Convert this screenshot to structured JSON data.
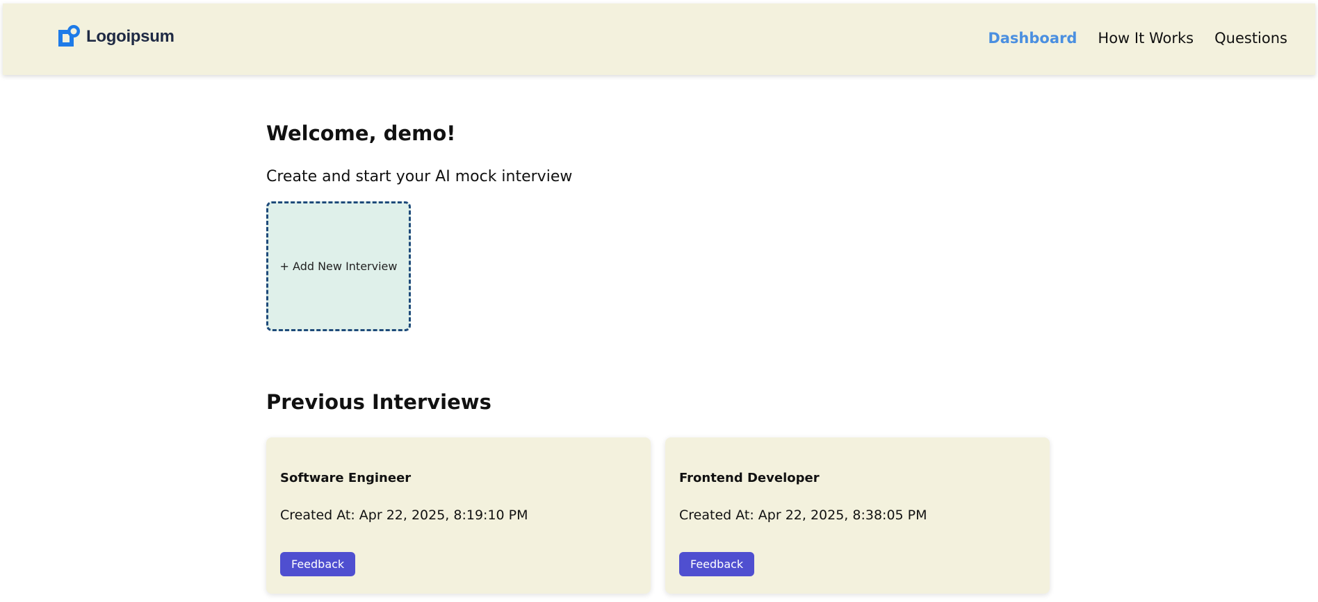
{
  "header": {
    "logo_text": "Logoipsum",
    "nav": [
      {
        "label": "Dashboard",
        "active": true
      },
      {
        "label": "How It Works",
        "active": false
      },
      {
        "label": "Questions",
        "active": false
      }
    ]
  },
  "main": {
    "welcome": "Welcome, demo!",
    "subtitle": "Create and start your AI mock interview",
    "add_interview_label": "+ Add New Interview",
    "previous_title": "Previous Interviews",
    "interviews": [
      {
        "title": "Software Engineer",
        "created": "Created At: Apr 22, 2025, 8:19:10 PM",
        "button": "Feedback"
      },
      {
        "title": "Frontend Developer",
        "created": "Created At: Apr 22, 2025, 8:38:05 PM",
        "button": "Feedback"
      }
    ]
  },
  "colors": {
    "header_bg": "#f3f1dd",
    "nav_active": "#4a8fe0",
    "logo_blue": "#1e7be8",
    "add_card_bg": "#dff0ea",
    "add_card_border": "#1e4a7a",
    "button_bg": "#4f4fd0"
  },
  "icons": {
    "logo": "logo-icon"
  }
}
